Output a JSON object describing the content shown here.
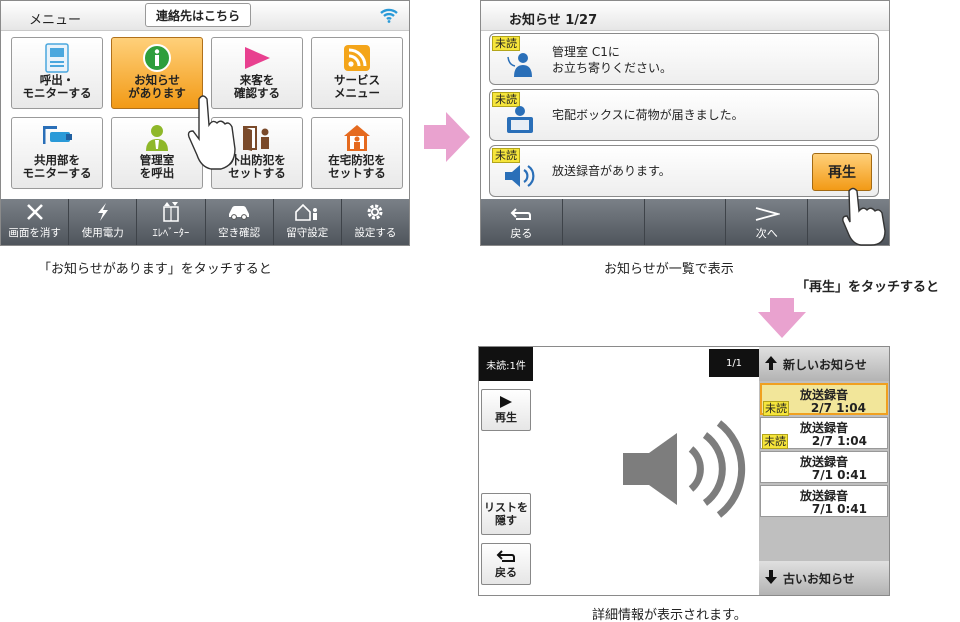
{
  "menu_panel": {
    "title": "メニュー",
    "contact_button": "連絡先はこちら",
    "tiles": [
      {
        "label": "呼出・\nモニターする",
        "icon": "intercom-icon",
        "active": false
      },
      {
        "label": "お知らせ\nがあります",
        "icon": "info-icon",
        "active": true
      },
      {
        "label": "来客を\n確認する",
        "icon": "flag-icon",
        "active": false
      },
      {
        "label": "サービス\nメニュー",
        "icon": "rss-icon",
        "active": false
      },
      {
        "label": "共用部を\nモニターする",
        "icon": "camera-icon",
        "active": false
      },
      {
        "label": "管理室\nを呼出",
        "icon": "manager-icon",
        "active": false
      },
      {
        "label": "外出防犯を\nセットする",
        "icon": "door-icon",
        "active": false
      },
      {
        "label": "在宅防犯を\nセットする",
        "icon": "home-person-icon",
        "active": false
      }
    ],
    "bottom_bar": [
      {
        "label": "画面を消す",
        "icon": "close-icon"
      },
      {
        "label": "使用電力",
        "icon": "lightning-icon"
      },
      {
        "label": "ｴﾚﾍﾞｰﾀｰ",
        "icon": "elevator-icon"
      },
      {
        "label": "空き確認",
        "icon": "car-icon"
      },
      {
        "label": "留守設定",
        "icon": "away-icon"
      },
      {
        "label": "設定する",
        "icon": "gear-icon"
      }
    ],
    "caption": "「お知らせがあります」をタッチすると"
  },
  "list_panel": {
    "title": "お知らせ 1/27",
    "messages": [
      {
        "badge": "未読",
        "text": "管理室 C1に\nお立ち寄りください。",
        "icon": "manager-icon"
      },
      {
        "badge": "未読",
        "text": "宅配ボックスに荷物が届きました。",
        "icon": "delivery-box-icon"
      },
      {
        "badge": "未読",
        "text": "放送録音があります。",
        "icon": "speaker-icon",
        "action": "再生"
      }
    ],
    "bottom_bar": [
      {
        "label": "戻る",
        "icon": "back-arrow-icon"
      },
      {
        "label": "",
        "icon": ""
      },
      {
        "label": "",
        "icon": ""
      },
      {
        "label": "次へ",
        "icon": "next-arrow-icon"
      },
      {
        "label": "",
        "icon": ""
      }
    ],
    "caption": "お知らせが一覧で表示",
    "play_caption": "「再生」をタッチすると"
  },
  "detail_panel": {
    "unread_count": "未読:1件",
    "page_indicator": "1/1",
    "play_button": "再生",
    "hide_list_button": "リストを\n隠す",
    "back_button": "戻る",
    "list_header": "新しいお知らせ",
    "list_footer": "古いお知らせ",
    "items": [
      {
        "title": "放送録音",
        "date": "2/7 1:04",
        "badge": "未読",
        "selected": true
      },
      {
        "title": "放送録音",
        "date": "2/7 1:04",
        "badge": "未読",
        "selected": false
      },
      {
        "title": "放送録音",
        "date": "7/1 0:41",
        "badge": "",
        "selected": false
      },
      {
        "title": "放送録音",
        "date": "7/1 0:41",
        "badge": "",
        "selected": false
      }
    ],
    "caption": "詳細情報が表示されます。"
  },
  "colors": {
    "accent_orange": "#f29a16",
    "unread_yellow": "#f6e53b",
    "bar_gray": "#5a6067",
    "arrow_pink": "#e9a2cf",
    "wifi_blue": "#2a9ad8"
  }
}
